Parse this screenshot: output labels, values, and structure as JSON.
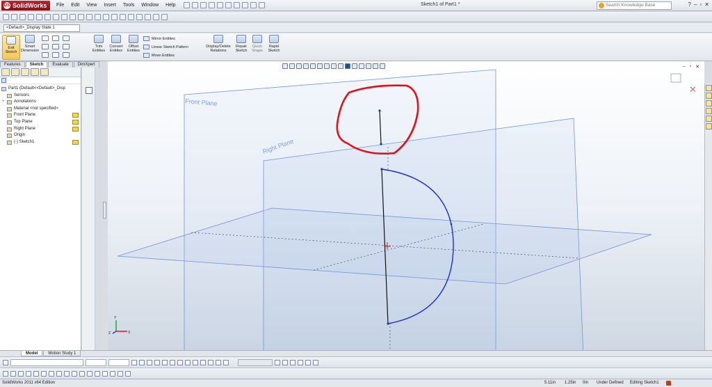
{
  "app": {
    "logo_text": "SolidWorks",
    "window_title": "Sketch1 of Part1 *",
    "menu": [
      "File",
      "Edit",
      "View",
      "Insert",
      "Tools",
      "Window",
      "Help"
    ],
    "search_placeholder": "Search Knowledge Base",
    "window_controls": [
      "?",
      "–",
      "▫",
      "✕"
    ]
  },
  "config": {
    "selected": "<Default>_Display State 1"
  },
  "command_manager": {
    "exit_sketch": "Exit\nSketch",
    "smart_dimension": "Smart\nDimension",
    "trim_entities": "Trim\nEntities",
    "convert_entities": "Convert\nEntities",
    "offset_entities": "Offset\nEntities",
    "mirror_entities": "Mirror Entities",
    "linear_sketch_pattern": "Linear Sketch Pattern",
    "move_entities": "Move Entities",
    "display_delete_relations": "Display/Delete\nRelations",
    "repair_sketch": "Repair\nSketch",
    "quick_snaps": "Quick\nSnaps",
    "rapid_sketch": "Rapid\nSketch"
  },
  "command_tabs": [
    "Features",
    "Sketch",
    "Evaluate",
    "DimXpert"
  ],
  "active_command_tab": "Sketch",
  "feature_tree": [
    {
      "label": "Part1  (Default<<Default>_Disp",
      "root": true
    },
    {
      "label": "Sensors"
    },
    {
      "label": "Annotations",
      "expander": "+"
    },
    {
      "label": "Material <not specified>"
    },
    {
      "label": "Front Plane",
      "side_icon": true
    },
    {
      "label": "Top Plane",
      "side_icon": true
    },
    {
      "label": "Right Plane",
      "side_icon": true
    },
    {
      "label": "Origin"
    },
    {
      "label": "(-) Sketch1",
      "side_icon": true
    }
  ],
  "graphics": {
    "front_plane_label": "Front Plane",
    "right_plane_label": "Right Plane",
    "axis_labels": {
      "x": "X",
      "y": "Y",
      "z": "Z"
    }
  },
  "bottom_tabs": [
    "Model",
    "Motion Study 1"
  ],
  "active_bottom_tab": "Model",
  "status": {
    "edition": "SolidWorks 2011 x64 Edition",
    "x": "5.11in",
    "y": "1.25in",
    "z": "0in",
    "sketch_state": "Under Defined",
    "editing": "Editing Sketch1"
  },
  "colors": {
    "plane_edge": "#6f93d9",
    "plane_label": "#7e9fe0",
    "sketch_arc": "#1b2fd0",
    "sketch_line": "#111111",
    "annotation_red": "#e2121a"
  }
}
